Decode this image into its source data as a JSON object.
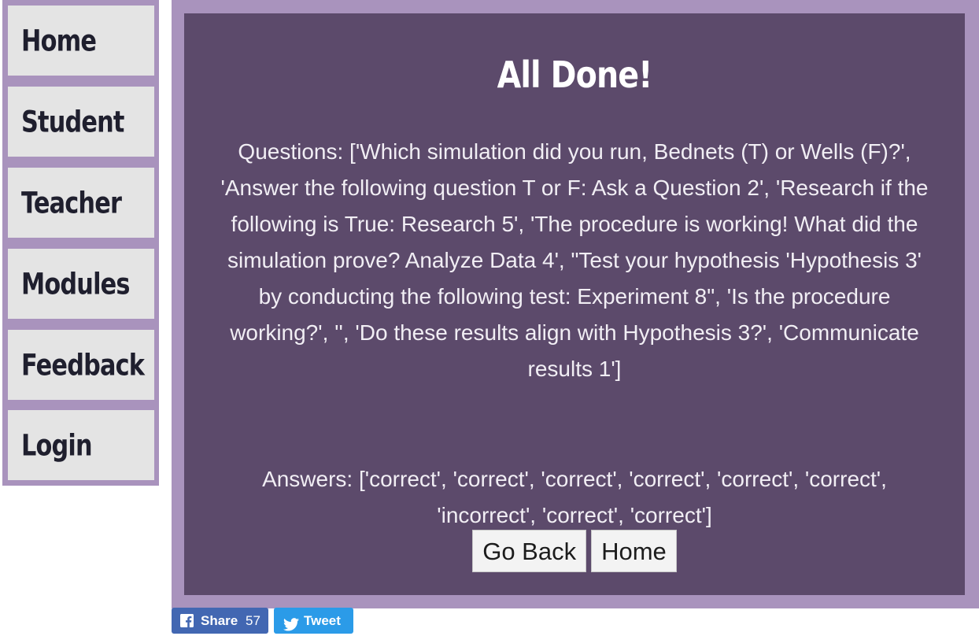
{
  "sidebar": {
    "items": [
      {
        "label": "Home"
      },
      {
        "label": "Student"
      },
      {
        "label": "Teacher"
      },
      {
        "label": "Modules"
      },
      {
        "label": "Feedback"
      },
      {
        "label": "Login"
      }
    ]
  },
  "main": {
    "title": "All Done!",
    "questions_text": "Questions: ['Which simulation did you run, Bednets (T) or Wells (F)?', 'Answer the following question T or F: Ask a Question 2', 'Research if the following is True: Research 5', 'The procedure is working! What did the simulation prove? Analyze Data 4', \"Test your hypothesis 'Hypothesis 3' by conducting the following test: Experiment 8\", 'Is the procedure working?', '', 'Do these results align with Hypothesis 3?', 'Communicate results 1']",
    "answers_text": "Answers: ['correct', 'correct', 'correct', 'correct', 'correct', 'correct', 'incorrect', 'correct', 'correct']",
    "buttons": {
      "go_back": "Go Back",
      "home": "Home"
    }
  },
  "social": {
    "share_label": "Share",
    "share_count": "57",
    "tweet_label": "Tweet"
  },
  "colors": {
    "frame": "#a993bd",
    "panel": "#5c4a6b",
    "nav_item": "#e4e4e4",
    "facebook": "#4267b2",
    "twitter": "#2b9be8"
  }
}
